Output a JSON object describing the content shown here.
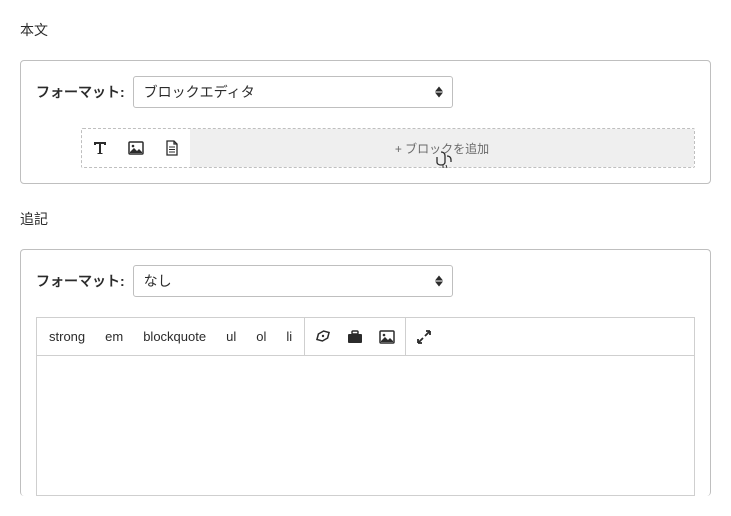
{
  "body": {
    "heading": "本文",
    "format_label": "フォーマット:",
    "format_value": "ブロックエディタ",
    "add_block_label": "+ ブロックを追加"
  },
  "extra": {
    "heading": "追記",
    "format_label": "フォーマット:",
    "format_value": "なし"
  },
  "toolbar": {
    "strong": "strong",
    "em": "em",
    "blockquote": "blockquote",
    "ul": "ul",
    "ol": "ol",
    "li": "li"
  }
}
